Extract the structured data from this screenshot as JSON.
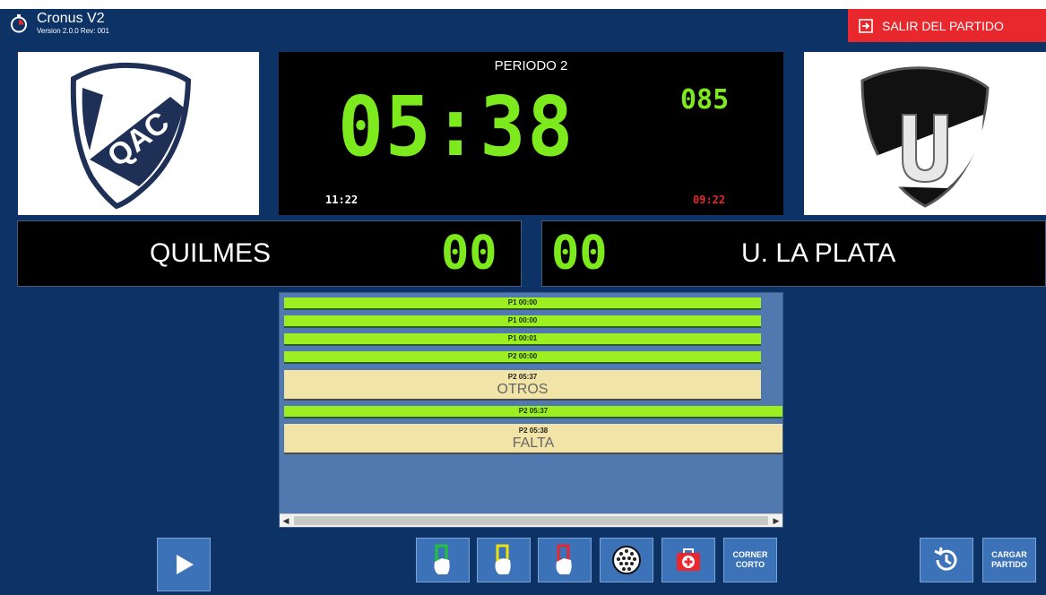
{
  "app": {
    "title": "Cronus V2",
    "version": "Version 2.0.0 Rev: 001"
  },
  "exit_button": {
    "label": "SALIR DEL PARTIDO"
  },
  "scoreboard": {
    "period_label": "PERIODO  2",
    "main_time": "05:38",
    "shot_clock": "085",
    "time_left": "11:22",
    "time_right": "09:22"
  },
  "teams": {
    "home": {
      "name": "QUILMES",
      "score": "00",
      "logo": "qac-crest"
    },
    "away": {
      "name": "U. LA PLATA",
      "score": "00",
      "logo": "u-crest"
    }
  },
  "events": [
    {
      "time": "P1 00:00",
      "kind": "green"
    },
    {
      "time": "P1 00:00",
      "kind": "green"
    },
    {
      "time": "P1 00:01",
      "kind": "green"
    },
    {
      "time": "P2 00:00",
      "kind": "green"
    },
    {
      "time": "P2 05:37",
      "label": "OTROS",
      "kind": "yellow"
    },
    {
      "time": "P2 05:37",
      "kind": "green"
    },
    {
      "time": "P2 05:38",
      "label": "FALTA",
      "kind": "yellow"
    }
  ],
  "controls": {
    "play": "play-icon",
    "cards": [
      "green-card-icon",
      "yellow-card-icon",
      "red-card-icon"
    ],
    "ball": "ball-icon",
    "medical": "first-aid-icon",
    "corner_label": "CORNER\nCORTO",
    "history": "history-icon",
    "load_label": "CARGAR\nPARTIDO"
  },
  "colors": {
    "background": "#0d3265",
    "exit": "#e8282d",
    "led": "#7dea1d",
    "event_green": "#9cf022",
    "event_yellow": "#f2e4a6"
  }
}
